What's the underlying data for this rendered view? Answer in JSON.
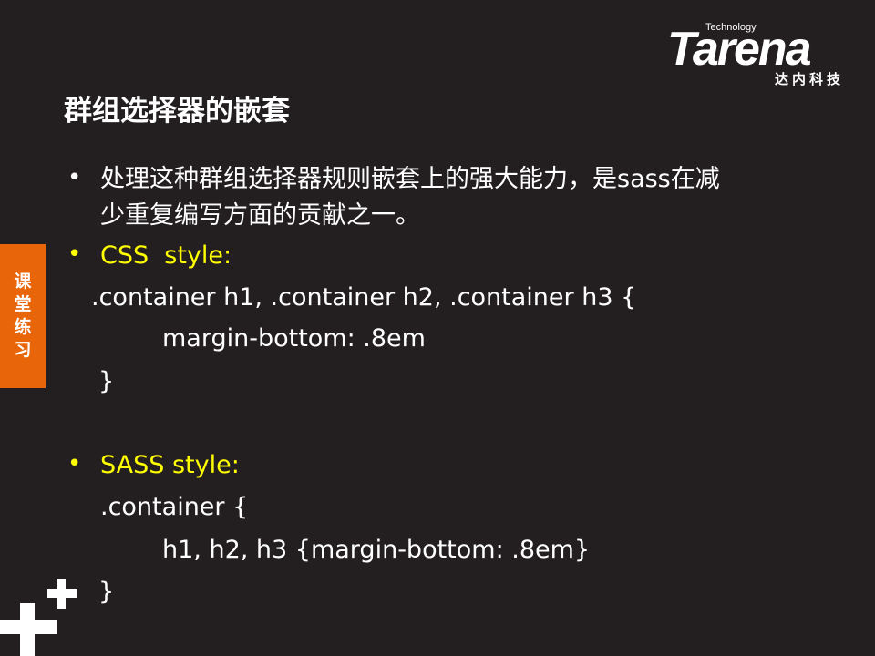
{
  "logo": {
    "tagline": "Technology",
    "wordmark": "Tarena",
    "chinese_name": "达内科技"
  },
  "title": "群组选择器的嵌套",
  "side_tab": [
    "课",
    "堂",
    "练",
    "习"
  ],
  "content": {
    "bullet1_line1": "处理这种群组选择器规则嵌套上的强大能力，是sass在减",
    "bullet1_line2": "少重复编写方面的贡献之一。",
    "css_heading": "CSS  style:",
    "css_line1": ".container h1, .container h2, .container h3 {",
    "css_line2": "margin-bottom: .8em",
    "css_line3": "}",
    "sass_heading": "SASS style:",
    "sass_line1": ".container {",
    "sass_line2": "h1, h2, h3 {margin-bottom: .8em}",
    "sass_line3": "}"
  },
  "colors": {
    "background": "#231f20",
    "accent": "#e8650a",
    "highlight": "#ffff00"
  }
}
